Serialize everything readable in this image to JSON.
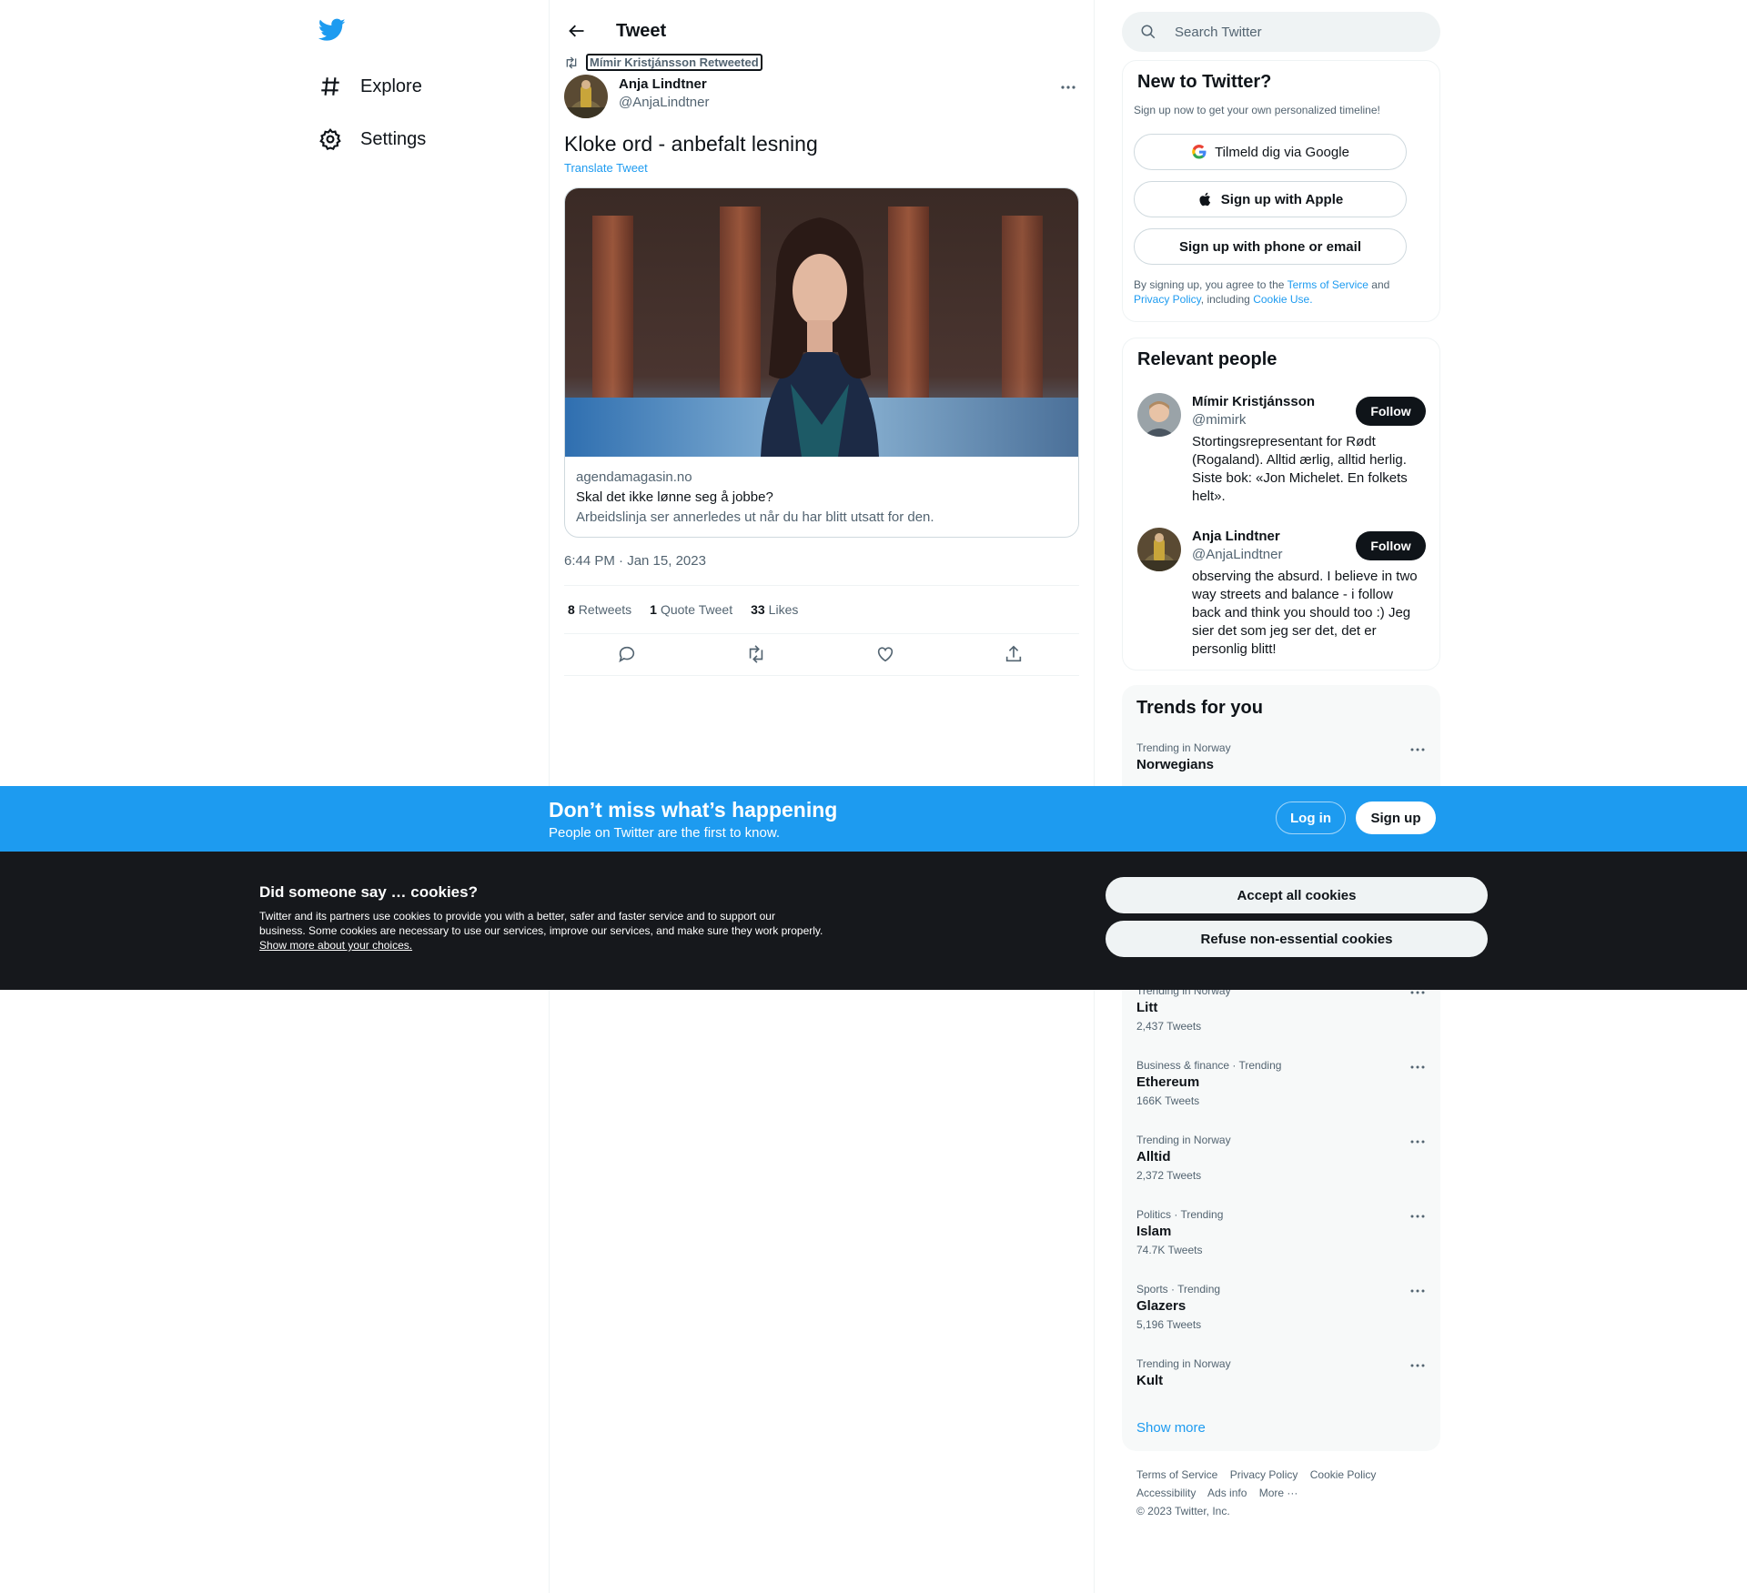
{
  "nav": {
    "explore": "Explore",
    "settings": "Settings"
  },
  "header": {
    "title": "Tweet"
  },
  "tweet": {
    "retweeted_by": "Mímir Kristjánsson Retweeted",
    "author_name": "Anja Lindtner",
    "author_handle": "@AnjaLindtner",
    "text": "Kloke ord - anbefalt lesning",
    "translate": "Translate Tweet",
    "card": {
      "domain": "agendamagasin.no",
      "title": "Skal det ikke lønne seg å jobbe?",
      "description": "Arbeidslinja ser annerledes ut når du har blitt utsatt for den."
    },
    "timestamp": "6:44 PM · Jan 15, 2023",
    "stats": {
      "retweets_count": "8",
      "retweets_label": "Retweets",
      "quotes_count": "1",
      "quotes_label": "Quote Tweet",
      "likes_count": "33",
      "likes_label": "Likes"
    }
  },
  "search": {
    "placeholder": "Search Twitter"
  },
  "new_to_twitter": {
    "title": "New to Twitter?",
    "subtitle": "Sign up now to get your own personalized timeline!",
    "google": "Tilmeld dig via Google",
    "apple": "Sign up with Apple",
    "phone": "Sign up with phone or email",
    "legal_prefix": "By signing up, you agree to the",
    "terms": "Terms of Service",
    "and": "and",
    "privacy": "Privacy Policy",
    "including": ", including",
    "cookie": "Cookie Use."
  },
  "relevant_people": {
    "title": "Relevant people",
    "people": [
      {
        "name": "Mímir Kristjánsson",
        "handle": "@mimirk",
        "bio": "Stortingsrepresentant for Rødt (Rogaland). Alltid ærlig, alltid herlig. Siste bok: «Jon Michelet. En folkets helt».",
        "follow": "Follow"
      },
      {
        "name": "Anja Lindtner",
        "handle": "@AnjaLindtner",
        "bio": "observing the absurd. I believe in two way streets and balance - i follow back and think you should too :) Jeg sier det som jeg ser det, det er personlig blitt!",
        "follow": "Follow"
      }
    ]
  },
  "trends": {
    "title": "Trends for you",
    "items": [
      {
        "meta": "Trending in Norway",
        "name": "Norwegians",
        "count": ""
      },
      {
        "meta": "Trending in Norway",
        "name": "Litt",
        "count": "2,437 Tweets"
      },
      {
        "meta": "Business & finance · Trending",
        "name": "Ethereum",
        "count": "166K Tweets"
      },
      {
        "meta": "Trending in Norway",
        "name": "Alltid",
        "count": "2,372 Tweets"
      },
      {
        "meta": "Politics · Trending",
        "name": "Islam",
        "count": "74.7K Tweets"
      },
      {
        "meta": "Sports · Trending",
        "name": "Glazers",
        "count": "5,196 Tweets"
      },
      {
        "meta": "Trending in Norway",
        "name": "Kult",
        "count": ""
      }
    ],
    "show_more": "Show more"
  },
  "footer": {
    "terms": "Terms of Service",
    "privacy": "Privacy Policy",
    "cookie": "Cookie Policy",
    "accessibility": "Accessibility",
    "ads": "Ads info",
    "more": "More ···",
    "copyright": "© 2023 Twitter, Inc."
  },
  "banner": {
    "title": "Don’t miss what’s happening",
    "subtitle": "People on Twitter are the first to know.",
    "login": "Log in",
    "signup": "Sign up"
  },
  "cookies": {
    "title": "Did someone say … cookies?",
    "text": "Twitter and its partners use cookies to provide you with a better, safer and faster service and to support our business. Some cookies are necessary to use our services, improve our services, and make sure they work properly.",
    "link": "Show more about your choices.",
    "accept": "Accept all cookies",
    "refuse": "Refuse non-essential cookies"
  },
  "colors": {
    "brand": "#1d9bf0",
    "text": "#0f1419",
    "muted": "#536471",
    "cookie_bg": "#16181c"
  }
}
